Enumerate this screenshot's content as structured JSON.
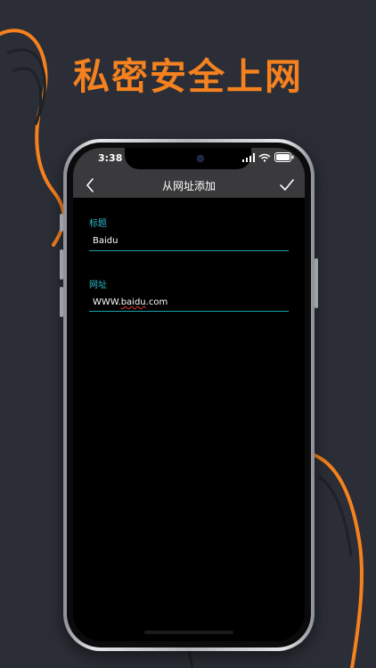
{
  "headline": "私密安全上网",
  "status_bar": {
    "time": "3:38"
  },
  "nav": {
    "title": "从网址添加"
  },
  "form": {
    "title_field": {
      "label": "标题",
      "value": "Baidu"
    },
    "url_field": {
      "label": "网址",
      "value_prefix": "WWW.",
      "value_spellcheck": "baidu",
      "value_suffix": ".com"
    }
  },
  "colors": {
    "accent": "#f5811f",
    "field_label": "#2ab7c9",
    "field_line": "#16a4a8",
    "background": "#2b2e36",
    "nav_bar": "#3a3a3c"
  },
  "icons": {
    "back": "chevron-left-icon",
    "confirm": "checkmark-icon",
    "wifi": "wifi-icon",
    "battery": "battery-icon"
  }
}
